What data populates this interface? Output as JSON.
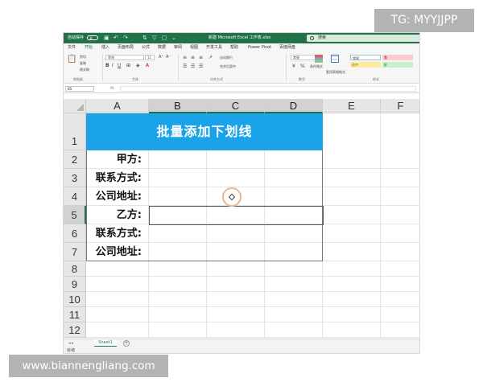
{
  "titlebar": {
    "autosave_label": "自动保存",
    "autosave_state": "关",
    "title": "新建 Microsoft Excel 工作表.xlsx",
    "search_placeholder": "搜索",
    "accent_color": "#217346"
  },
  "ribbon_tabs": [
    "文件",
    "开始",
    "插入",
    "页面布局",
    "公式",
    "数据",
    "审阅",
    "视图",
    "开发工具",
    "帮助",
    "Power Pivot",
    "百度网盘"
  ],
  "active_tab": "开始",
  "ribbon": {
    "clipboard": {
      "cut": "剪切",
      "copy": "复制",
      "format_painter": "格式刷",
      "label": "剪贴板"
    },
    "font": {
      "name": "等线",
      "size": "11",
      "label": "字体"
    },
    "alignment": {
      "wrap": "自动换行",
      "merge": "合并后居中",
      "label": "对齐方式"
    },
    "number": {
      "format": "常规",
      "label": "数字"
    },
    "styles": {
      "conditional_format": "条件格式",
      "format_as_table": "套用表格格式",
      "normal": "常规",
      "bad": "差",
      "neutral": "适中",
      "good": "好",
      "label": "样式"
    }
  },
  "formula_bar": {
    "name_box": "B5",
    "fx": "fx",
    "content": ""
  },
  "columns": [
    "A",
    "B",
    "C",
    "D",
    "E",
    "F"
  ],
  "selected_columns": [
    "B",
    "C",
    "D"
  ],
  "rows": [
    "1",
    "2",
    "3",
    "4",
    "5",
    "6",
    "7",
    "8",
    "9",
    "10",
    "11",
    "12"
  ],
  "selected_row": "5",
  "sheet": {
    "title": "批量添加下划线",
    "title_fill": "#1BA3EA",
    "labels": [
      "甲方:",
      "联系方式:",
      "公司地址:",
      "乙方:",
      "联系方式:",
      "公司地址:"
    ]
  },
  "sheet_tabs": [
    "Sheet1"
  ],
  "status": "就绪",
  "watermarks": {
    "top_right": "TG: MYYJJPP",
    "bottom_left": "www.biannengliang.com"
  }
}
